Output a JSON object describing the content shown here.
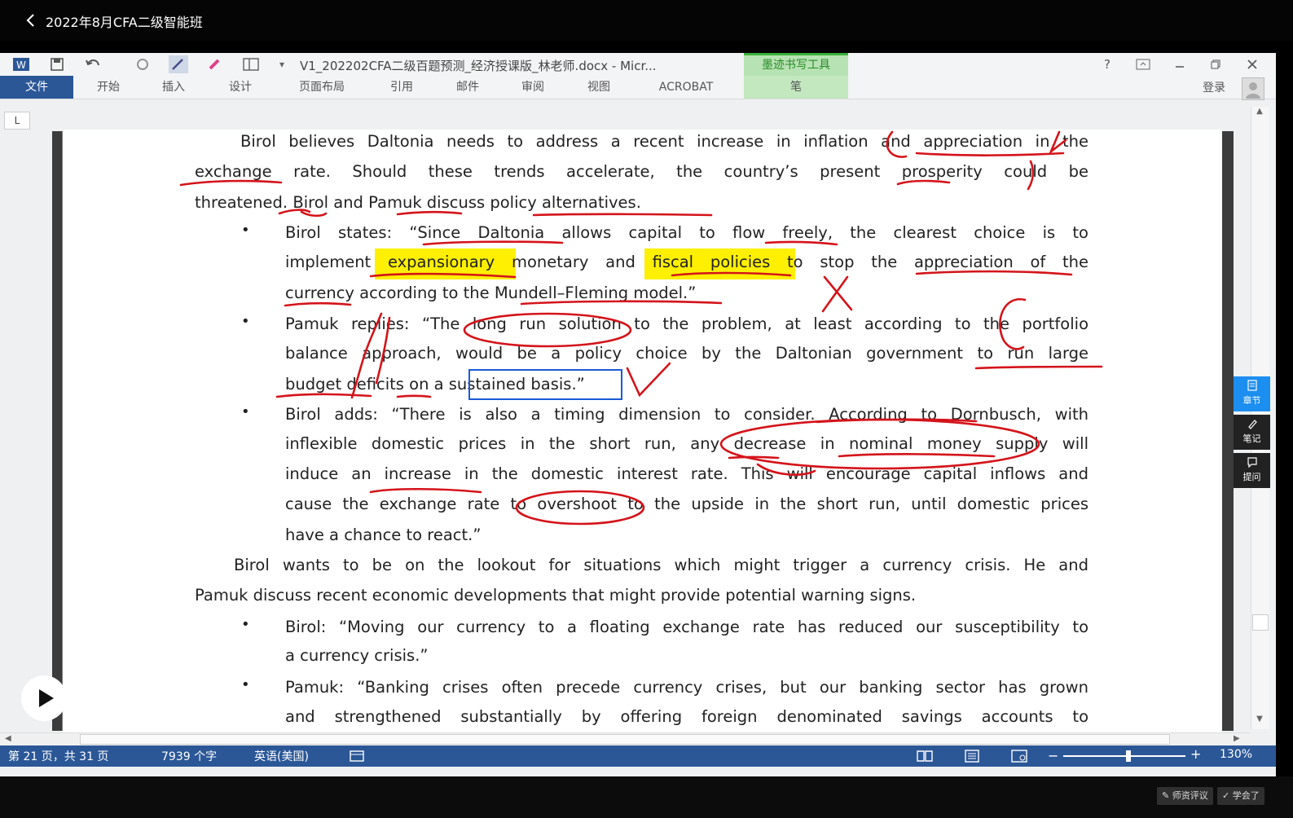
{
  "header": {
    "back_icon": "chevron-left-icon",
    "title": "2022年8月CFA二级智能班"
  },
  "word": {
    "doc_title": "V1_202202CFA二级百题预测_经济授课版_林老师.docx - Micr...",
    "ink_tools_tab": "墨迹书写工具",
    "tabs": [
      "文件",
      "开始",
      "插入",
      "设计",
      "页面布局",
      "引用",
      "邮件",
      "审阅",
      "视图",
      "ACROBAT",
      "笔"
    ],
    "login": "登录",
    "ruler_corner": "L",
    "window_buttons": [
      "?",
      "restore-icon",
      "minimize-icon",
      "maximize-icon",
      "close-icon"
    ]
  },
  "document": {
    "paragraph1": [
      "Birol believes Daltonia needs to address a recent increase in inflation and appreciation in the",
      "exchange rate. Should these trends accelerate, the country’s present prosperity could be",
      "threatened. Birol and Pamuk discuss policy alternatives."
    ],
    "bullet1": [
      "Birol states: “Since Daltonia allows capital to flow freely, the clearest choice is to",
      "implement expansionary monetary and fiscal policies to stop the appreciation of the",
      "currency according to the Mundell–Fleming model.”"
    ],
    "bullet2": [
      "Pamuk replies: “The long run solution to the problem, at least according to the portfolio",
      "balance approach, would be a policy choice by the Daltonian government to run large",
      "budget deficits on a sustained basis.”"
    ],
    "bullet3": [
      "Birol adds: “There is also a timing dimension to consider. According to Dornbusch, with",
      "inflexible domestic prices in the short run, any decrease in nominal money supply will",
      "induce an increase in the domestic interest rate. This will encourage capital inflows and",
      "cause the exchange rate to overshoot to the upside in the short run, until domestic prices",
      "have a chance to react.”"
    ],
    "paragraph2": [
      "Birol wants to be on the lookout for situations which might trigger a currency crisis. He and",
      "Pamuk discuss recent economic developments that might provide potential warning signs."
    ],
    "bullet4": [
      "Birol: “Moving our currency to a floating exchange rate has reduced our susceptibility to",
      "a currency crisis.”"
    ],
    "bullet5": [
      "Pamuk: “Banking crises often precede currency crises, but our banking sector has grown",
      "and strengthened substantially by offering foreign denominated savings accounts to"
    ]
  },
  "status": {
    "page": "第 21 页，共 31 页",
    "words": "7939 个字",
    "language": "英语(美国)",
    "zoom": "130%",
    "zoom_minus": "−",
    "zoom_plus": "+"
  },
  "side_panel": {
    "chapter": "章节",
    "notes": "笔记",
    "ask": "提问"
  },
  "footer": {
    "rate_teacher": "师资评议",
    "learned": "学会了"
  },
  "colors": {
    "ink": "#d4131a",
    "highlight": "#ffef00",
    "ribbon_blue": "#2b5797",
    "side_active": "#1c8ef0"
  }
}
